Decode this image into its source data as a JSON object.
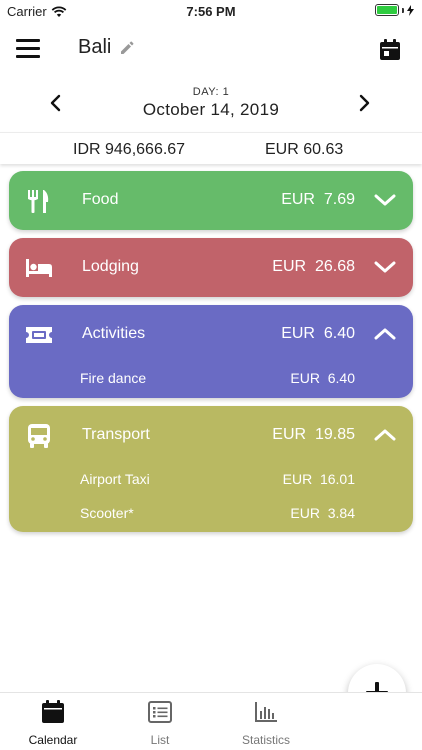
{
  "status_bar": {
    "carrier": "Carrier",
    "time": "7:56 PM"
  },
  "header": {
    "title": "Bali"
  },
  "day_nav": {
    "day_label": "DAY: 1",
    "date": "October 14, 2019"
  },
  "totals": {
    "idr": "IDR 946,666.67",
    "eur": "EUR 60.63"
  },
  "categories": [
    {
      "name": "Food",
      "amount": "EUR  7.69",
      "expanded": false,
      "color": "#66bb6a",
      "icon": "fork-knife-icon",
      "items": []
    },
    {
      "name": "Lodging",
      "amount": "EUR  26.68",
      "expanded": false,
      "color": "#c1636a",
      "icon": "bed-icon",
      "items": []
    },
    {
      "name": "Activities",
      "amount": "EUR  6.40",
      "expanded": true,
      "color": "#6a6bc4",
      "icon": "ticket-icon",
      "items": [
        {
          "name": "Fire dance",
          "amount": "EUR  6.40"
        }
      ]
    },
    {
      "name": "Transport",
      "amount": "EUR  19.85",
      "expanded": true,
      "color": "#b9b962",
      "icon": "bus-icon",
      "items": [
        {
          "name": "Airport Taxi",
          "amount": "EUR  16.01"
        },
        {
          "name": "Scooter*",
          "amount": "EUR  3.84"
        }
      ]
    }
  ],
  "tabs": [
    {
      "label": "Calendar",
      "icon": "calendar-icon",
      "active": true
    },
    {
      "label": "List",
      "icon": "list-icon",
      "active": false
    },
    {
      "label": "Statistics",
      "icon": "bar-chart-icon",
      "active": false
    }
  ],
  "colors": {
    "active_tab": "#111111",
    "inactive_tab": "#777777"
  }
}
